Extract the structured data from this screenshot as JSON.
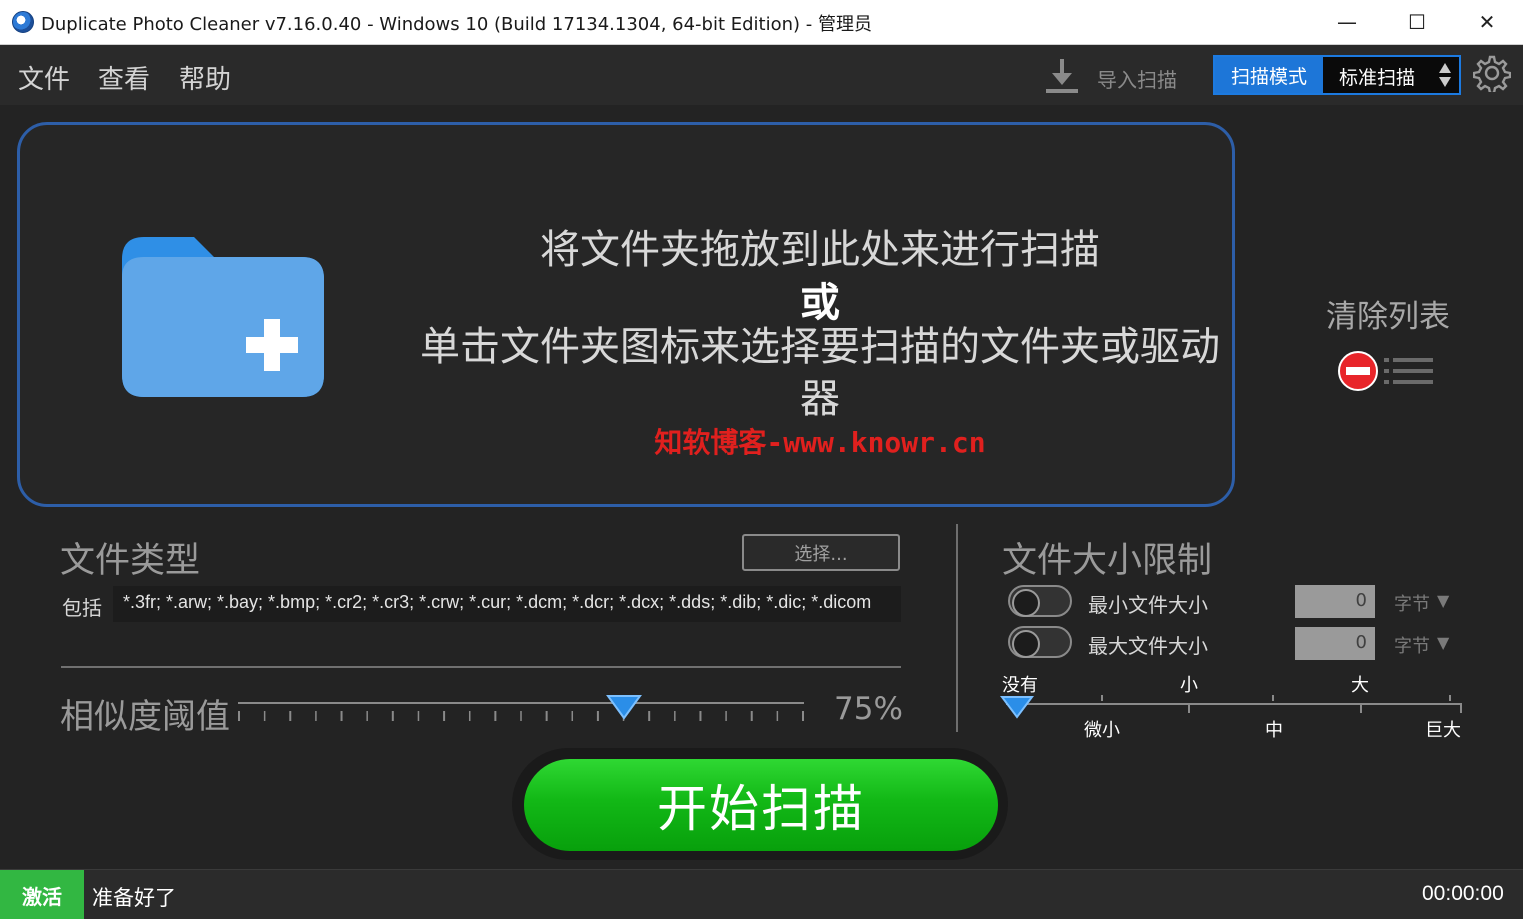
{
  "window": {
    "title": "Duplicate Photo Cleaner v7.16.0.40 - Windows 10 (Build 17134.1304, 64-bit Edition) - 管理员",
    "min_glyph": "—",
    "max_glyph": "☐",
    "close_glyph": "✕"
  },
  "menu": {
    "file": "文件",
    "view": "查看",
    "help": "帮助"
  },
  "toolbar": {
    "import_label": "导入扫描",
    "mode_label": "扫描模式",
    "mode_value": "标准扫描",
    "mode_arrows": "▲\n▼"
  },
  "dropzone": {
    "line1": "将文件夹拖放到此处来进行扫描",
    "line2": "或",
    "line3": "单击文件夹图标来选择要扫描的文件夹或驱动器",
    "watermark": "知软博客-www.knowr.cn",
    "folder_color": "#5fa6e8",
    "folder_tab_color": "#2f8fe6"
  },
  "clear_list": {
    "label": "清除列表"
  },
  "file_types": {
    "title": "文件类型",
    "select_button": "选择...",
    "include_label": "包括",
    "include_value": "*.3fr; *.arw; *.bay; *.bmp; *.cr2; *.cr3; *.crw; *.cur; *.dcm; *.dcr; *.dcx; *.dds; *.dib; *.dic; *.dicom"
  },
  "similarity": {
    "label": "相似度阈值",
    "value_text": "75%",
    "value": 75
  },
  "file_size": {
    "title": "文件大小限制",
    "min_label": "最小文件大小",
    "max_label": "最大文件大小",
    "min_value": "0",
    "max_value": "0",
    "unit": "字节",
    "unit_arrow": "▼",
    "scale_top": [
      "没有",
      "小",
      "大"
    ],
    "scale_bottom": [
      "微小",
      "中",
      "巨大"
    ]
  },
  "start_button": "开始扫描",
  "status": {
    "activate": "激活",
    "message": "准备好了",
    "timer": "00:00:00"
  },
  "colors": {
    "accent": "#1d76d8",
    "start_green": "#12b816",
    "activate_green": "#32b742",
    "watermark_red": "#e0201e",
    "clear_red": "#e8252a"
  }
}
